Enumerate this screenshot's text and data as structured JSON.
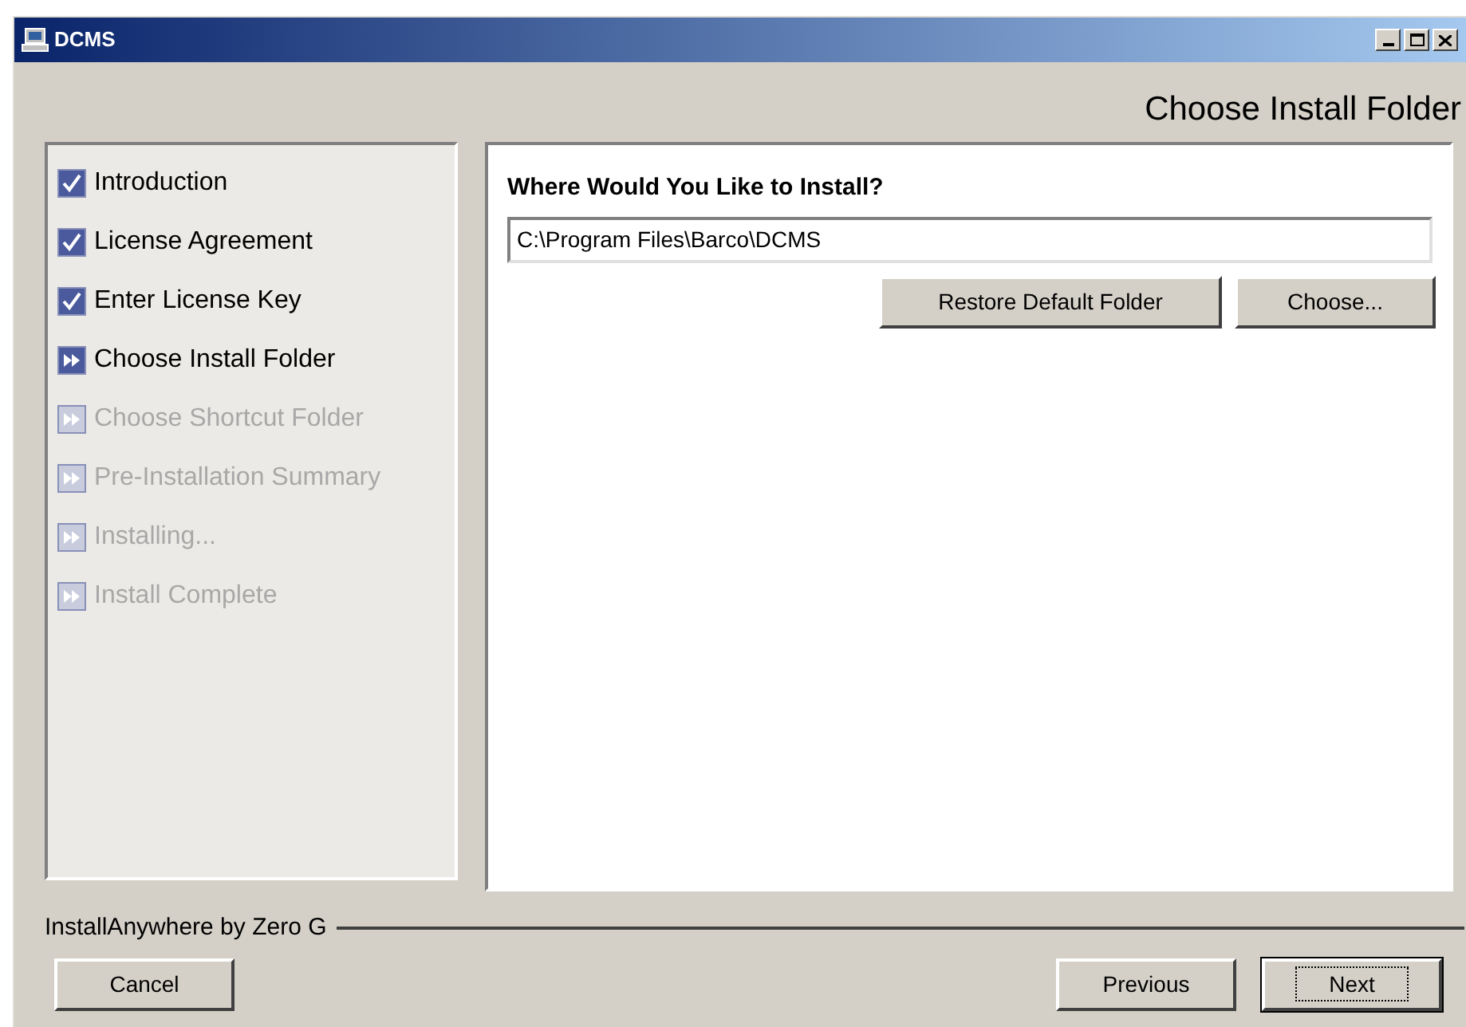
{
  "window": {
    "title": "DCMS"
  },
  "header": {
    "title": "Choose Install Folder"
  },
  "steps": [
    {
      "label": "Introduction",
      "kind": "done"
    },
    {
      "label": "License Agreement",
      "kind": "done"
    },
    {
      "label": "Enter License Key",
      "kind": "done"
    },
    {
      "label": "Choose Install Folder",
      "kind": "current"
    },
    {
      "label": "Choose Shortcut Folder",
      "kind": "pending"
    },
    {
      "label": "Pre-Installation Summary",
      "kind": "pending"
    },
    {
      "label": "Installing...",
      "kind": "pending"
    },
    {
      "label": "Install Complete",
      "kind": "pending"
    }
  ],
  "content": {
    "heading": "Where Would You Like to Install?",
    "path": {
      "value": "C:\\Program Files\\Barco\\DCMS"
    },
    "buttons": [
      "Restore Default Folder",
      "Choose..."
    ]
  },
  "footer": {
    "vendor": "InstallAnywhere by Zero G",
    "buttons": {
      "left": [
        "Cancel"
      ],
      "right": [
        {
          "label": "Previous",
          "default": false
        },
        {
          "label": "Next",
          "default": true
        }
      ]
    }
  }
}
